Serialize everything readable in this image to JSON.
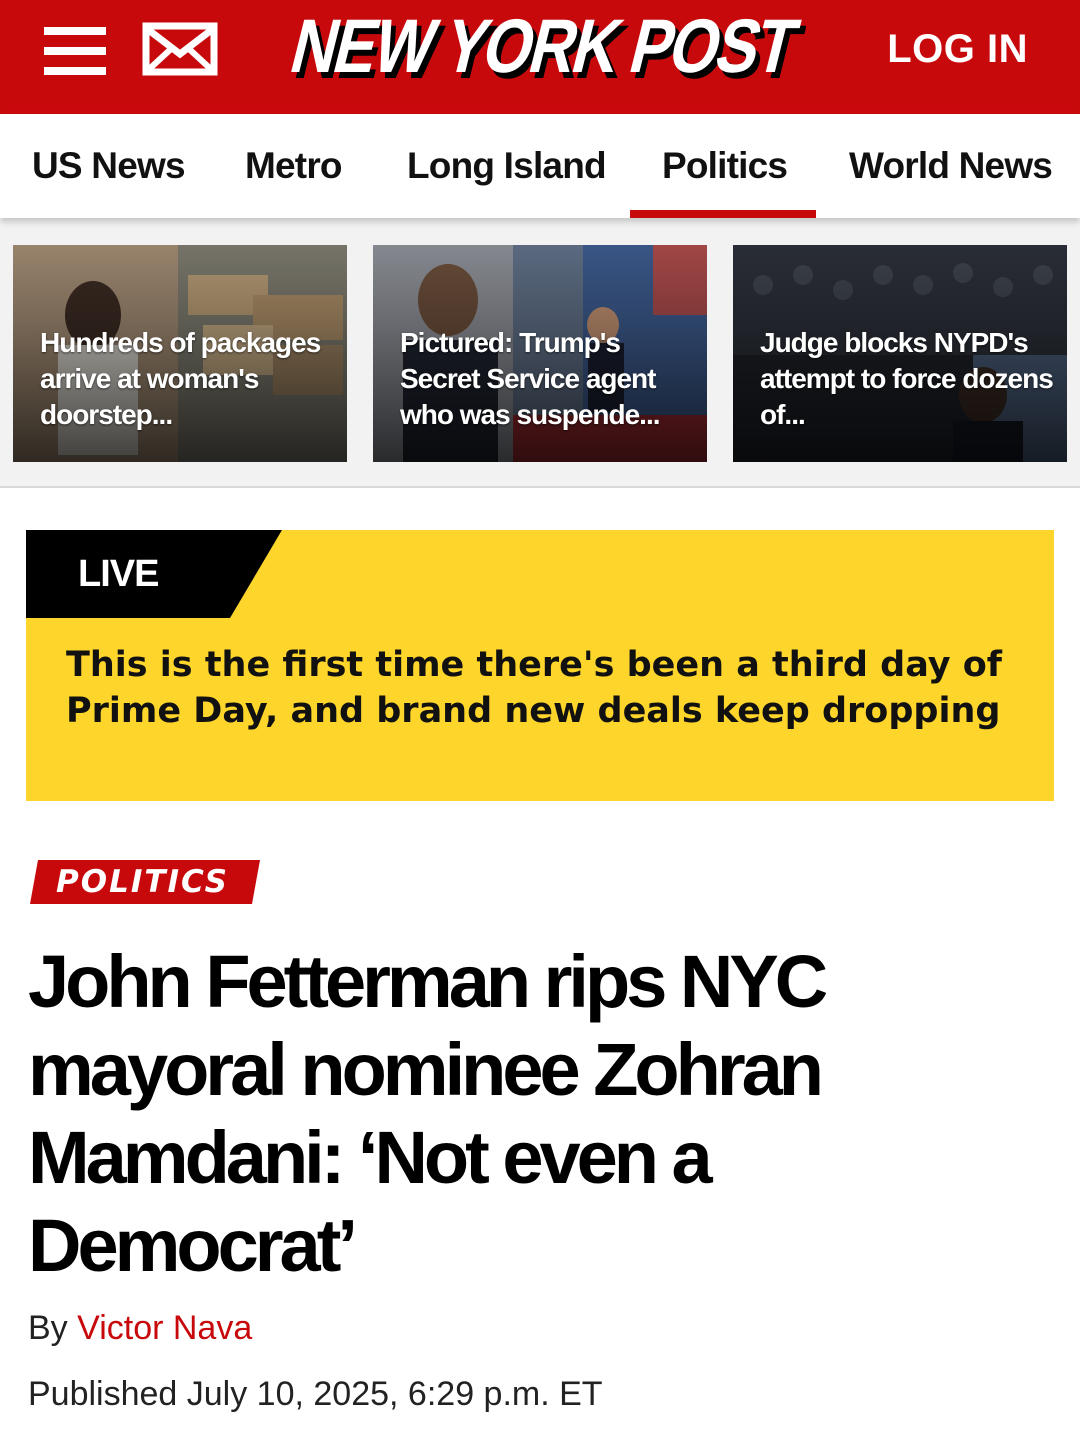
{
  "header": {
    "brand": "NEW YORK POST",
    "login_label": "LOG IN",
    "brand_color": "#c8090c"
  },
  "section_nav": {
    "items": [
      {
        "label": "US News"
      },
      {
        "label": "Metro"
      },
      {
        "label": "Long Island"
      },
      {
        "label": "Politics",
        "active": true
      },
      {
        "label": "World News"
      }
    ]
  },
  "story_strip": {
    "cards": [
      {
        "caption": "Hundreds of packages arrive at woman's doorstep..."
      },
      {
        "caption": "Pictured: Trump's Secret Service agent who was suspende..."
      },
      {
        "caption": "Judge blocks NYPD's attempt to force dozens of..."
      }
    ]
  },
  "live": {
    "tag": "LIVE",
    "text": "This is the first time there's been a third day of Prime Day, and brand new deals keep dropping",
    "accent_color": "#fdd52b"
  },
  "article": {
    "kicker": "POLITICS",
    "headline": "John Fetterman rips NYC mayoral nominee Zohran Mamdani: ‘Not even a Democrat’",
    "byline_prefix": "By ",
    "author": "Victor Nava",
    "published": "Published July 10, 2025, 6:29 p.m. ET"
  }
}
